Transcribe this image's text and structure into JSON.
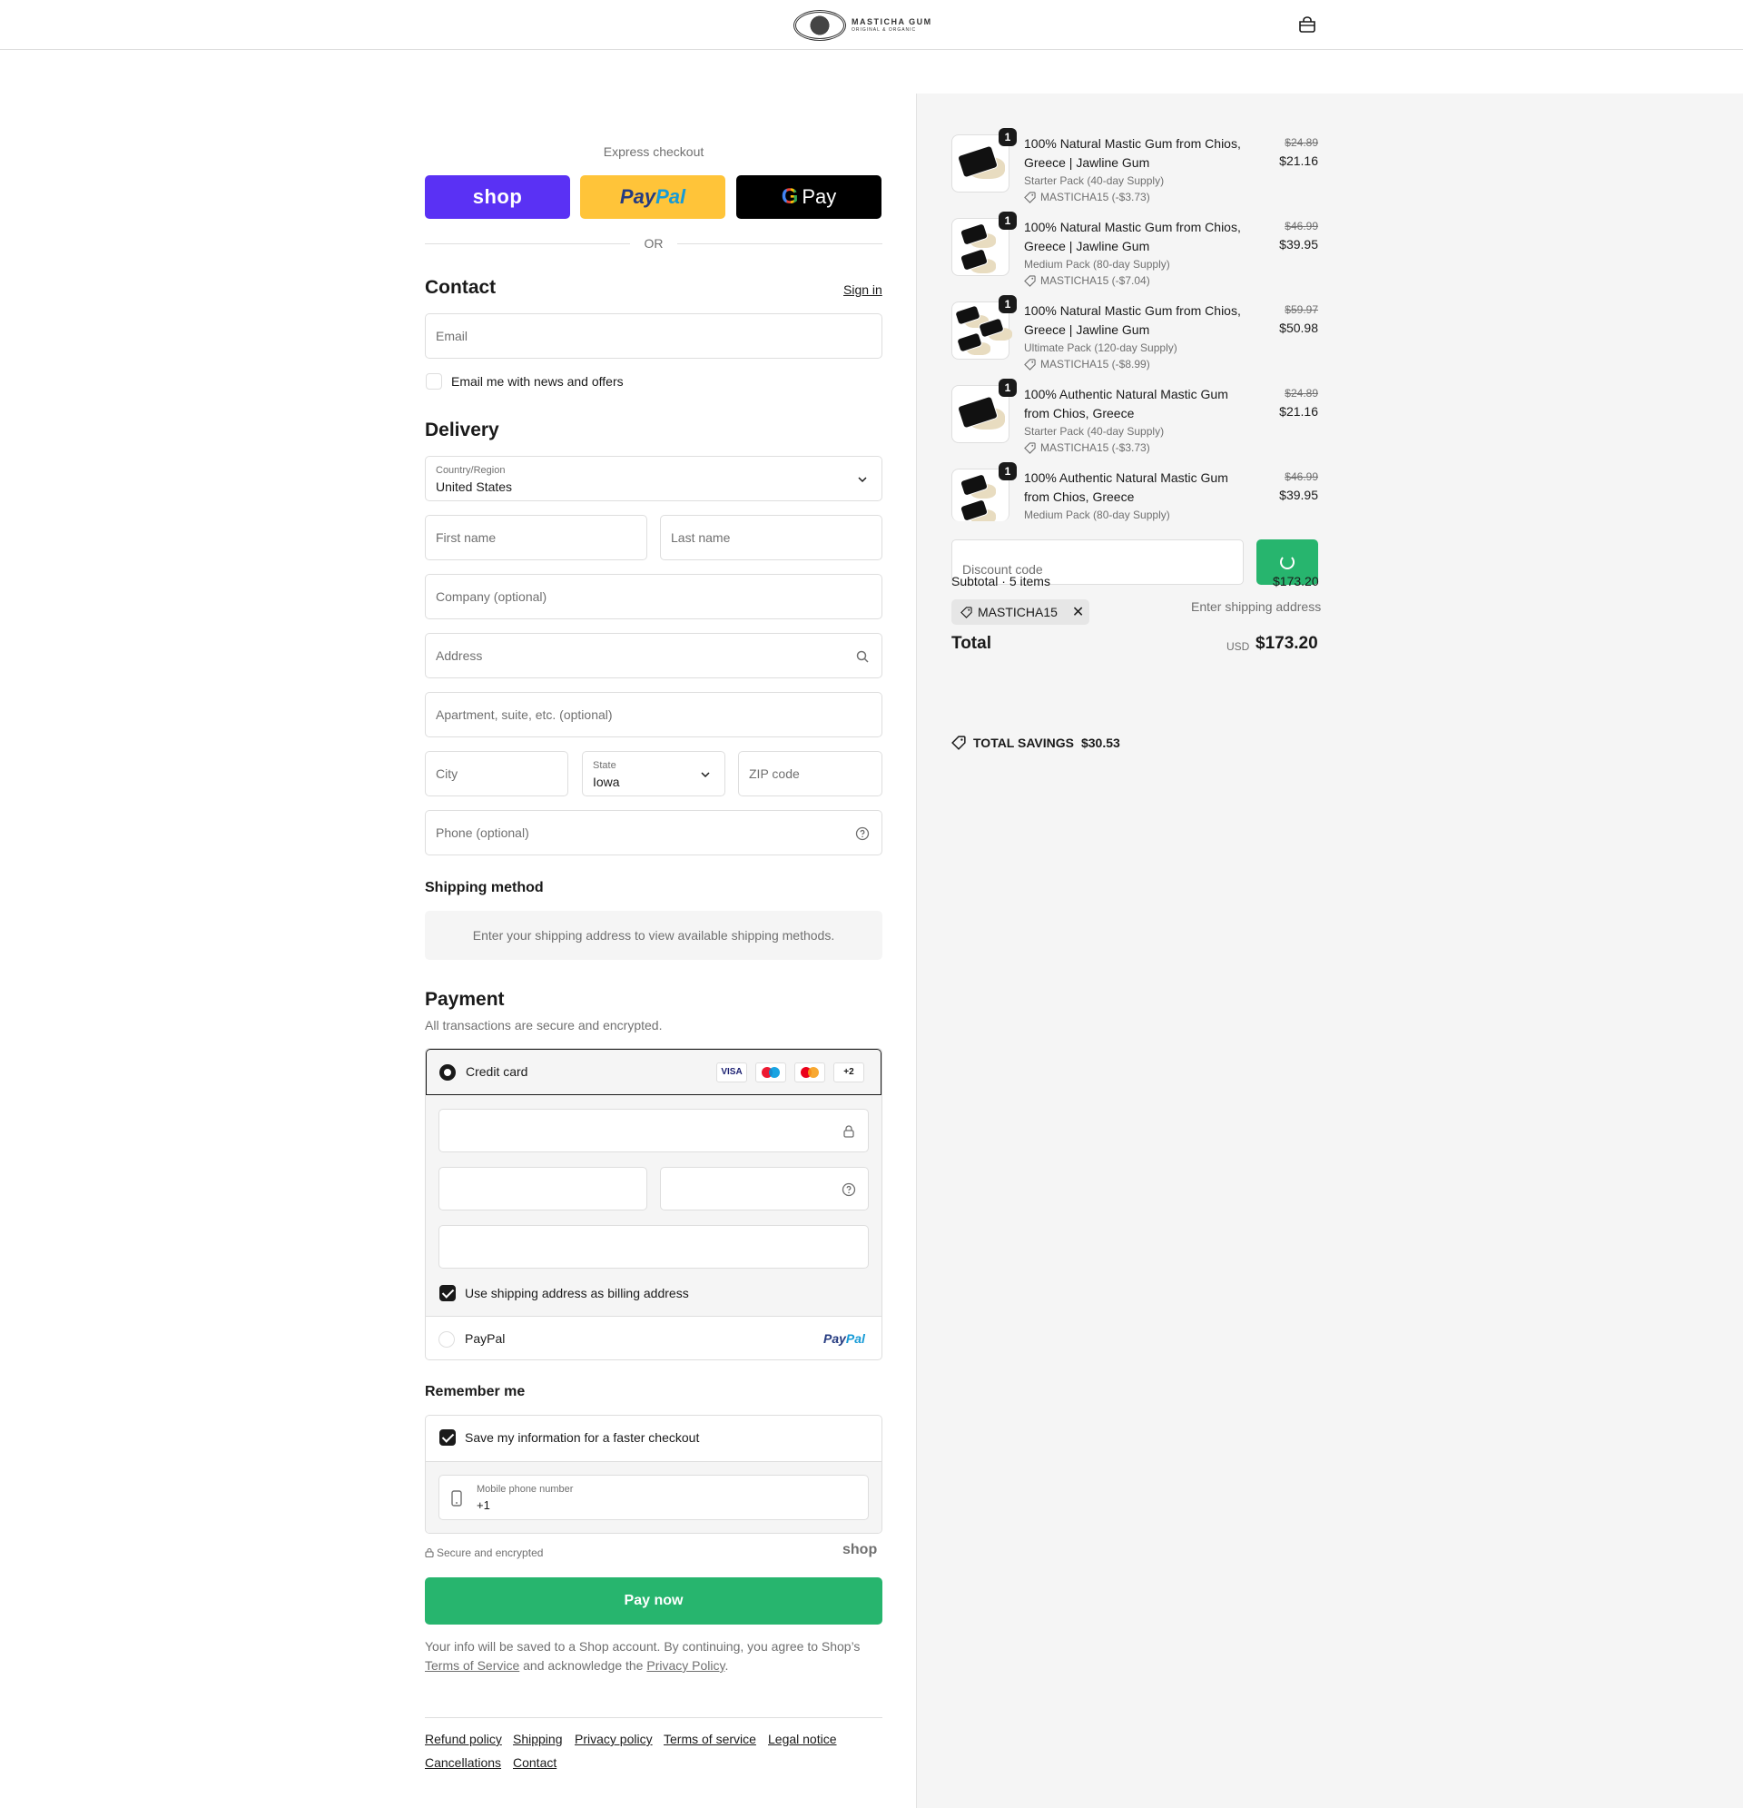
{
  "header": {
    "brand": "MASTICHA GUM",
    "brand_tagline": "ORIGINAL & ORGANIC",
    "cart_icon": "shopping-bag-icon"
  },
  "express": {
    "title": "Express checkout",
    "shop_label": "shop",
    "paypal_a": "Pay",
    "paypal_b": "Pal",
    "gpay_g": "G",
    "gpay_label": "Pay",
    "or": "OR"
  },
  "contact": {
    "heading": "Contact",
    "signin": "Sign in",
    "email_placeholder": "Email",
    "newsletter_label": "Email me with news and offers"
  },
  "delivery": {
    "heading": "Delivery",
    "country_label": "Country/Region",
    "country_value": "United States",
    "first_name": "First name",
    "last_name": "Last name",
    "company": "Company (optional)",
    "address": "Address",
    "apartment": "Apartment, suite, etc. (optional)",
    "city": "City",
    "state_label": "State",
    "state_value": "Iowa",
    "zip": "ZIP code",
    "phone": "Phone (optional)"
  },
  "shipping": {
    "heading": "Shipping method",
    "info": "Enter your shipping address to view available shipping methods."
  },
  "payment": {
    "heading": "Payment",
    "subtitle": "All transactions are secure and encrypted.",
    "credit_card_label": "Credit card",
    "card_logos": [
      "VISA",
      "maestro",
      "mastercard",
      "+2"
    ],
    "billing_label": "Use shipping address as billing address",
    "paypal_label": "PayPal",
    "paypal_logo_a": "Pay",
    "paypal_logo_b": "Pal"
  },
  "remember": {
    "heading": "Remember me",
    "save_label": "Save my information for a faster checkout",
    "mobile_label": "Mobile phone number",
    "mobile_value": "+1"
  },
  "secure": {
    "text": "Secure and encrypted",
    "shop_mark": "shop"
  },
  "pay_now": "Pay now",
  "legal": {
    "part1": "Your info will be saved to a Shop account. By continuing, you agree to Shop’s",
    "terms": "Terms of Service",
    "part2": "and acknowledge the",
    "privacy": "Privacy Policy",
    "end": "."
  },
  "footer": {
    "links": [
      "Refund policy",
      "Shipping",
      "Privacy policy",
      "Terms of service",
      "Legal notice",
      "Cancellations",
      "Contact"
    ]
  },
  "summary": {
    "items": [
      {
        "qty": "1",
        "title": "100% Natural Mastic Gum from Chios, Greece | Jawline Gum",
        "variant": "Starter Pack (40-day Supply)",
        "discount": "MASTICHA15 (-$3.73)",
        "old_price": "$24.89",
        "price": "$21.16",
        "tins": 1
      },
      {
        "qty": "1",
        "title": "100% Natural Mastic Gum from Chios, Greece | Jawline Gum",
        "variant": "Medium Pack (80-day Supply)",
        "discount": "MASTICHA15 (-$7.04)",
        "old_price": "$46.99",
        "price": "$39.95",
        "tins": 2
      },
      {
        "qty": "1",
        "title": "100% Natural Mastic Gum from Chios, Greece | Jawline Gum",
        "variant": "Ultimate Pack (120-day Supply)",
        "discount": "MASTICHA15 (-$8.99)",
        "old_price": "$59.97",
        "price": "$50.98",
        "tins": 3
      },
      {
        "qty": "1",
        "title": "100% Authentic Natural Mastic Gum from Chios, Greece",
        "variant": "Starter Pack (40-day Supply)",
        "discount": "MASTICHA15 (-$3.73)",
        "old_price": "$24.89",
        "price": "$21.16",
        "tins": 1
      },
      {
        "qty": "1",
        "title": "100% Authentic Natural Mastic Gum from Chios, Greece",
        "variant": "Medium Pack (80-day Supply)",
        "discount": "",
        "old_price": "$46.99",
        "price": "$39.95",
        "tins": 2
      }
    ],
    "discount_placeholder": "Discount code",
    "subtotal_label": "Subtotal · 5 items",
    "subtotal_value": "$173.20",
    "applied_code": "MASTICHA15",
    "shipping_note": "Enter shipping address",
    "total_label": "Total",
    "currency": "USD",
    "total_value": "$173.20",
    "savings_label": "TOTAL SAVINGS",
    "savings_value": "$30.53"
  },
  "colors": {
    "shop_purple": "#5a31f4",
    "paypal_yellow": "#ffc439",
    "pay_green": "#27b56e",
    "text": "#1a1a1a",
    "muted": "#707070"
  }
}
